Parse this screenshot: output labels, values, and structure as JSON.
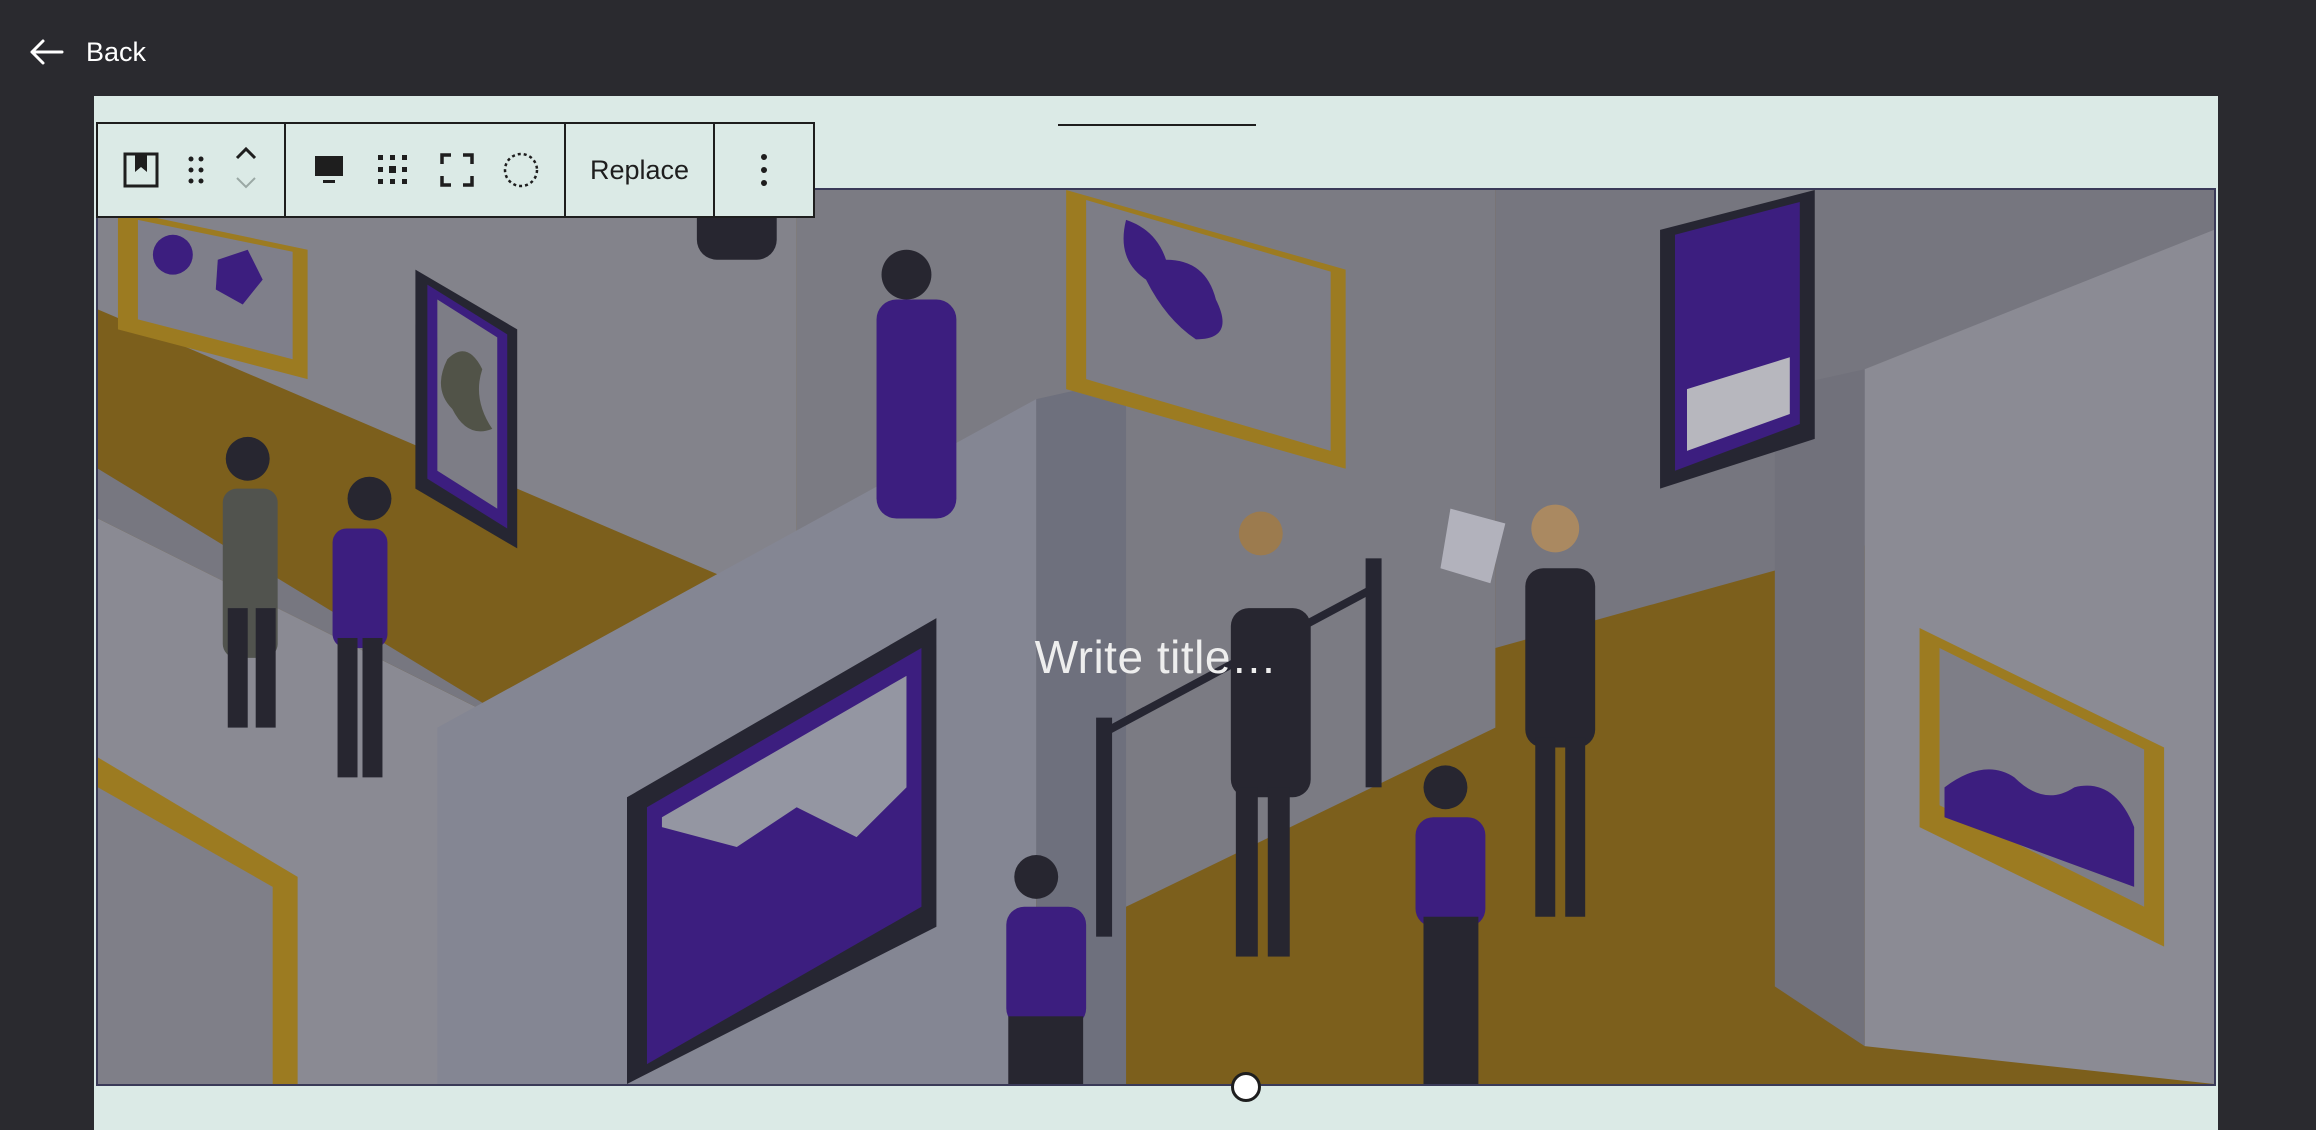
{
  "nav": {
    "back_label": "Back",
    "back_icon": "arrow-left-icon"
  },
  "toolbar": {
    "block_icon": "cover-block-icon",
    "drag_icon": "drag-handle-icon",
    "move_up_icon": "chevron-up-icon",
    "move_down_icon": "chevron-down-icon",
    "content_position_icon": "align-content-icon",
    "matrix_icon": "position-matrix-icon",
    "full_height_icon": "full-height-icon",
    "duotone_icon": "circle-dashed-icon",
    "replace_label": "Replace",
    "more_icon": "more-vertical-icon"
  },
  "cover": {
    "title_placeholder": "Write title…",
    "image_subject": "isometric art gallery illustration with visitors",
    "colors": {
      "wall": "#8f8f96",
      "floor": "#8b6a1c",
      "accent_purple": "#43208c",
      "frame_gold": "#b08a22",
      "background": "#dbeae6",
      "page_dark": "#2a2a2f"
    }
  }
}
